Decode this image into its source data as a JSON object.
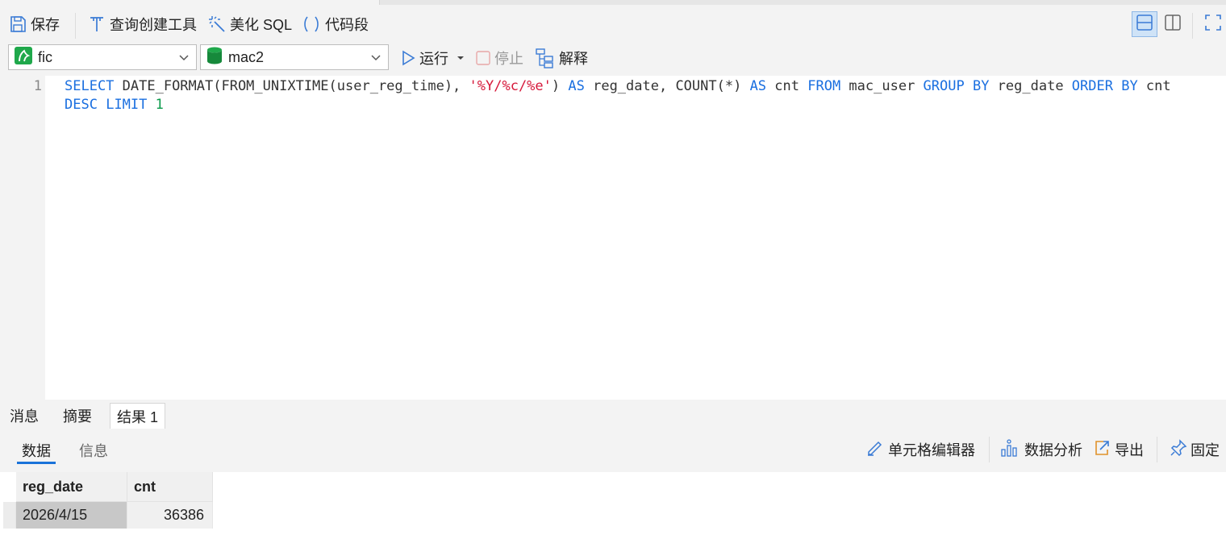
{
  "toolbar": {
    "save_label": "保存",
    "query_builder_label": "查询创建工具",
    "beautify_label": "美化 SQL",
    "snippet_label": "代码段"
  },
  "runbar": {
    "connection": "fic",
    "database": "mac2",
    "run_label": "运行",
    "stop_label": "停止",
    "explain_label": "解释"
  },
  "editor": {
    "line_number": "1",
    "tokens": [
      {
        "t": "SELECT",
        "c": "kw"
      },
      {
        "t": " DATE_FORMAT(FROM_UNIXTIME(user_reg_time), ",
        "c": "id"
      },
      {
        "t": "'%Y/%c/%e'",
        "c": "str"
      },
      {
        "t": ") ",
        "c": "id"
      },
      {
        "t": "AS",
        "c": "kw"
      },
      {
        "t": " reg_date, COUNT(*) ",
        "c": "id"
      },
      {
        "t": "AS",
        "c": "kw"
      },
      {
        "t": " cnt ",
        "c": "id"
      },
      {
        "t": "FROM",
        "c": "kw"
      },
      {
        "t": " mac_user ",
        "c": "id"
      },
      {
        "t": "GROUP BY",
        "c": "kw"
      },
      {
        "t": " reg_date ",
        "c": "id"
      },
      {
        "t": "ORDER BY",
        "c": "kw"
      },
      {
        "t": " cnt ",
        "c": "id"
      },
      {
        "t": "DESC",
        "c": "kw"
      },
      {
        "t": " ",
        "c": "id"
      },
      {
        "t": "LIMIT",
        "c": "kw"
      },
      {
        "t": " ",
        "c": "id"
      },
      {
        "t": "1",
        "c": "num"
      }
    ]
  },
  "result_tabs": [
    "消息",
    "摘要",
    "结果 1"
  ],
  "result_subtabs": {
    "data": "数据",
    "info": "信息"
  },
  "result_tools": {
    "cell_editor": "单元格编辑器",
    "data_analysis": "数据分析",
    "export": "导出",
    "pin": "固定"
  },
  "table": {
    "columns": [
      "reg_date",
      "cnt"
    ],
    "rows": [
      [
        "2026/4/15",
        "36386"
      ]
    ]
  },
  "colors": {
    "keyword": "#1a6fe0",
    "string": "#d6193b",
    "number": "#0a9a4a",
    "accent": "#1a73d9"
  }
}
